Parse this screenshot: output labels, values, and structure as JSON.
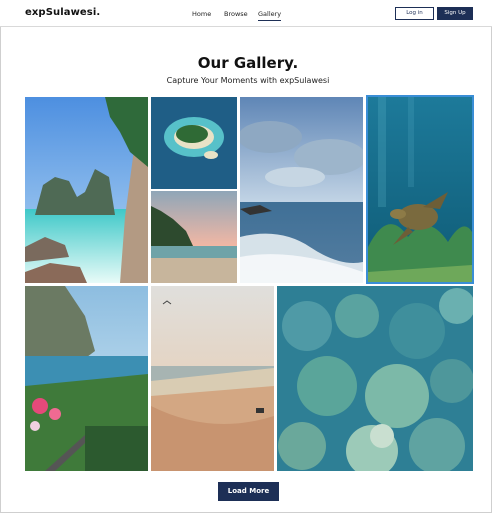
{
  "nav": {
    "logo": "expSulawesi.",
    "links": [
      "Home",
      "Browse",
      "Gallery"
    ],
    "login_label": "Log in",
    "signup_label": "Sign Up"
  },
  "hero": {
    "title": "Our Gallery.",
    "subtitle": "Capture Your Moments with expSulawesi"
  },
  "gallery": {
    "photos": [
      "cliff-beach",
      "island-aerial",
      "sunset-shore",
      "cloudy-sea",
      "sea-turtle",
      "coastal-cliff",
      "sandy-beach",
      "coral-reef"
    ]
  },
  "actions": {
    "load_more_label": "Load More"
  },
  "colors": {
    "brand": "#1d2f56",
    "accent_border": "#3a8ed6"
  }
}
